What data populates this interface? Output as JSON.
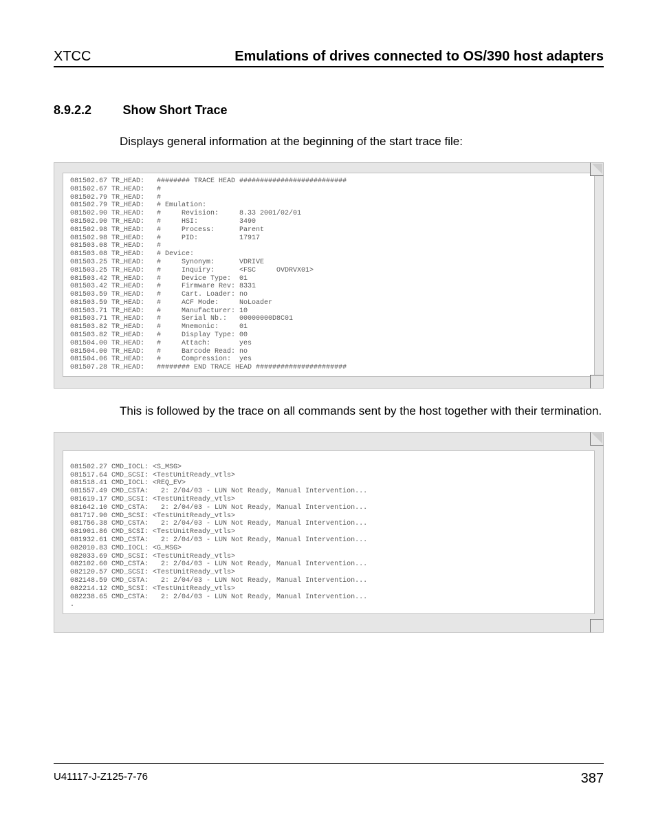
{
  "header": {
    "left": "XTCC",
    "right": "Emulations of drives connected to OS/390 host adapters"
  },
  "section": {
    "number": "8.9.2.2",
    "title": "Show Short Trace"
  },
  "para1": "Displays general information at the beginning of the start trace file:",
  "code1": "081502.67 TR_HEAD:   ######## TRACE HEAD ##########################\n081502.67 TR_HEAD:   #\n081502.79 TR_HEAD:   #\n081502.79 TR_HEAD:   # Emulation:\n081502.90 TR_HEAD:   #     Revision:     8.33 2001/02/01\n081502.90 TR_HEAD:   #     HSI:          3490\n081502.98 TR_HEAD:   #     Process:      Parent\n081502.98 TR_HEAD:   #     PID:          17917\n081503.08 TR_HEAD:   #\n081503.08 TR_HEAD:   # Device:\n081503.25 TR_HEAD:   #     Synonym:      VDRIVE\n081503.25 TR_HEAD:   #     Inquiry:      <FSC     OVDRVX01>\n081503.42 TR_HEAD:   #     Device Type:  01\n081503.42 TR_HEAD:   #     Firmware Rev: 8331\n081503.59 TR_HEAD:   #     Cart. Loader: no\n081503.59 TR_HEAD:   #     ACF Mode:     NoLoader\n081503.71 TR_HEAD:   #     Manufacturer: 10\n081503.71 TR_HEAD:   #     Serial Nb.:   00000000D8C01\n081503.82 TR_HEAD:   #     Mnemonic:     01\n081503.82 TR_HEAD:   #     Display Type: 00\n081504.00 TR_HEAD:   #     Attach:       yes\n081504.00 TR_HEAD:   #     Barcode Read: no\n081504.06 TR_HEAD:   #     Compression:  yes\n081507.28 TR_HEAD:   ######## END TRACE HEAD ######################",
  "para2": "This is followed by the trace on all commands sent by the host together with their termination.",
  "code2": "\n081502.27 CMD_IOCL: <S_MSG>\n081517.64 CMD_SCSI: <TestUnitReady_vtls>\n081518.41 CMD_IOCL: <REQ_EV>\n081557.49 CMD_CSTA:   2: 2/04/03 - LUN Not Ready, Manual Intervention...\n081619.17 CMD_SCSI: <TestUnitReady_vtls>\n081642.10 CMD_CSTA:   2: 2/04/03 - LUN Not Ready, Manual Intervention...\n081717.90 CMD_SCSI: <TestUnitReady_vtls>\n081756.38 CMD_CSTA:   2: 2/04/03 - LUN Not Ready, Manual Intervention...\n081901.86 CMD_SCSI: <TestUnitReady_vtls>\n081932.61 CMD_CSTA:   2: 2/04/03 - LUN Not Ready, Manual Intervention...\n082010.83 CMD_IOCL: <G_MSG>\n082033.69 CMD_SCSI: <TestUnitReady_vtls>\n082102.60 CMD_CSTA:   2: 2/04/03 - LUN Not Ready, Manual Intervention...\n082120.57 CMD_SCSI: <TestUnitReady_vtls>\n082148.59 CMD_CSTA:   2: 2/04/03 - LUN Not Ready, Manual Intervention...\n082214.12 CMD_SCSI: <TestUnitReady_vtls>\n082238.65 CMD_CSTA:   2: 2/04/03 - LUN Not Ready, Manual Intervention...\n.",
  "footer": {
    "doc": "U41117-J-Z125-7-76",
    "page": "387"
  }
}
